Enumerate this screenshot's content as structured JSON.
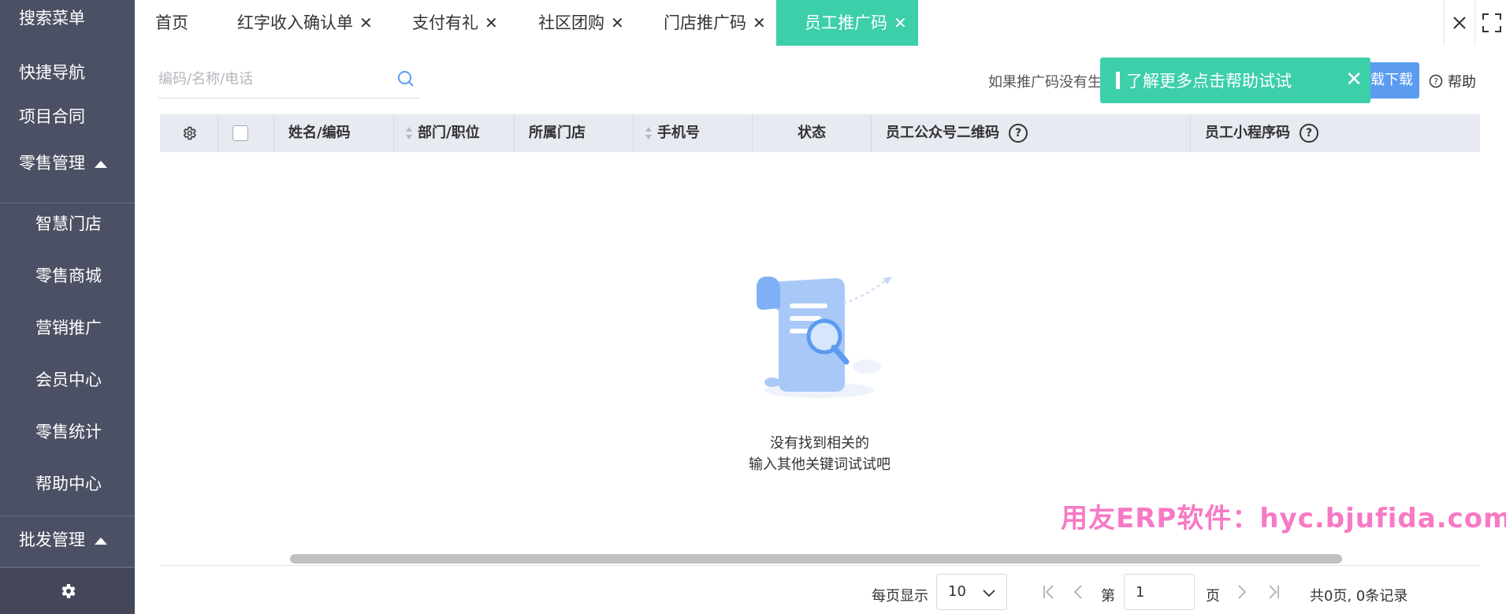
{
  "sidebar": {
    "items": [
      {
        "label": "搜索菜单"
      },
      {
        "label": "快捷导航"
      },
      {
        "label": "项目合同"
      }
    ],
    "retail": {
      "label": "零售管理",
      "children": [
        "智慧门店",
        "零售商城",
        "营销推广",
        "会员中心",
        "零售统计",
        "帮助中心"
      ]
    },
    "wholesale": {
      "label": "批发管理"
    }
  },
  "tabs": [
    {
      "label": "首页",
      "closable": false
    },
    {
      "label": "红字收入确认单",
      "closable": true
    },
    {
      "label": "支付有礼",
      "closable": true
    },
    {
      "label": "社区团购",
      "closable": true
    },
    {
      "label": "门店推广码",
      "closable": true
    },
    {
      "label": "员工推广码",
      "closable": true,
      "active": true
    }
  ],
  "toolbar": {
    "search_placeholder": "编码/名称/电话",
    "hint_text": "如果推广码没有生",
    "download_label": "载下载",
    "help_label": "帮助"
  },
  "toast": {
    "message": "了解更多点击帮助试试"
  },
  "table": {
    "columns": [
      "姓名/编码",
      "部门/职位",
      "所属门店",
      "手机号",
      "状态",
      "员工公众号二维码",
      "员工小程序码"
    ]
  },
  "empty": {
    "line1": "没有找到相关的",
    "line2": "输入其他关键词试试吧"
  },
  "watermark": "用友ERP软件：hyc.bjufida.com",
  "pagination": {
    "per_page_label": "每页显示",
    "per_page_value": "10",
    "page_prefix": "第",
    "page_value": "1",
    "page_suffix": "页",
    "summary": "共0页, 0条记录"
  },
  "colors": {
    "sidebar_bg": "#4c5064",
    "accent_green": "#3ccfaa",
    "primary_blue": "#5b9bf0",
    "watermark_pink": "#f779c4"
  }
}
